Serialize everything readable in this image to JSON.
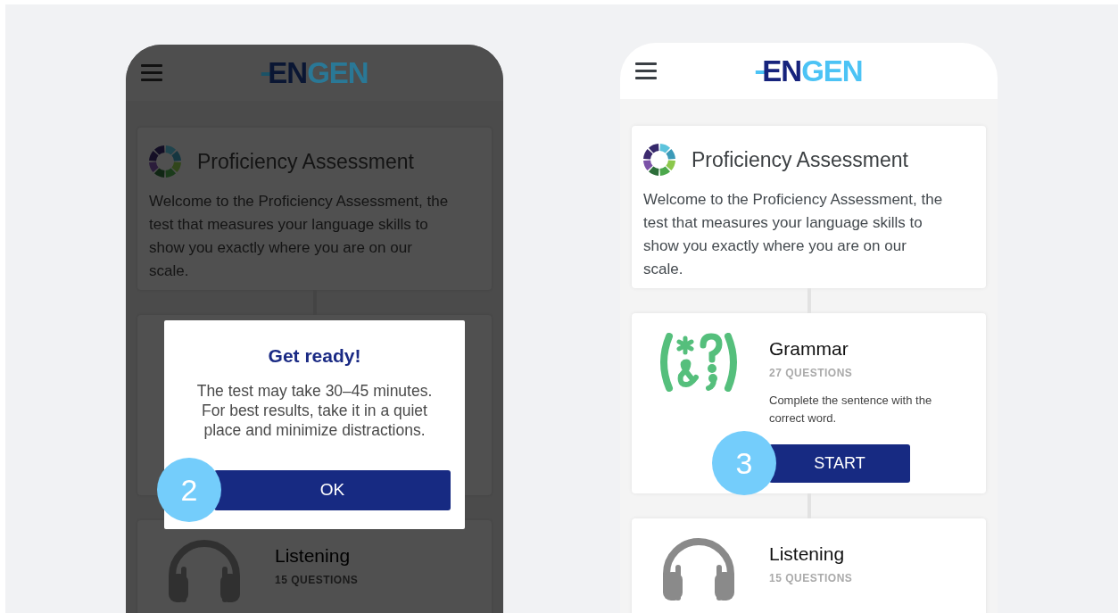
{
  "phones": [
    {
      "dimmed": true,
      "header": {
        "logo": [
          {
            "text": "EN"
          },
          {
            "text": "GEN"
          }
        ]
      },
      "cards": [
        {
          "kind": "intro",
          "title": "Proficiency Assessment",
          "text": "Welcome to the Proficiency Assessment, the test that measures your language skills to show you exactly where you are on our scale."
        },
        {
          "kind": "covered"
        },
        {
          "kind": "listening",
          "title": "Listening",
          "count": "15 QUESTIONS"
        }
      ],
      "dialog": {
        "title": "Get ready!",
        "text": "The test may take 30–45 minutes. For best results, take it in a quiet place and minimize distractions.",
        "button": {
          "label": "OK",
          "step": "2"
        }
      }
    },
    {
      "dimmed": false,
      "header": {
        "logo": [
          {
            "text": "EN"
          },
          {
            "text": "GEN"
          }
        ]
      },
      "cards": [
        {
          "kind": "intro",
          "title": "Proficiency Assessment",
          "text": "Welcome to the Proficiency Assessment, the test that measures your language skills to show you exactly where you are on our scale."
        },
        {
          "kind": "grammar",
          "title": "Grammar",
          "count": "27 QUESTIONS",
          "text": "Complete the sentence with the correct word.",
          "button": {
            "label": "START",
            "step": "3"
          }
        },
        {
          "kind": "listening",
          "title": "Listening",
          "count": "15 QUESTIONS"
        }
      ]
    }
  ]
}
